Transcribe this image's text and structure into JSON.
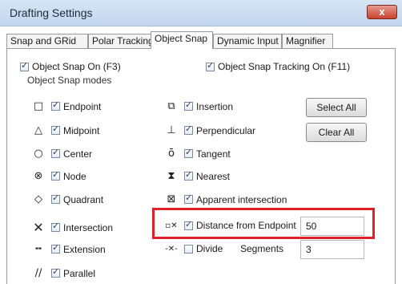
{
  "window": {
    "title": "Drafting Settings",
    "close_glyph": "x"
  },
  "tabs": [
    {
      "label": "Snap and GRid"
    },
    {
      "label": "Polar Tracking"
    },
    {
      "label": "Object Snap"
    },
    {
      "label": "Dynamic Input"
    },
    {
      "label": "Magnifier"
    }
  ],
  "active_tab": "Object Snap",
  "toggles": {
    "snap_on": {
      "label": "Object Snap On (F3)",
      "checked": true
    },
    "tracking_on": {
      "label": "Object Snap Tracking On (F11)",
      "checked": true
    }
  },
  "modes_group": {
    "label": "Object Snap modes"
  },
  "modes_left": [
    {
      "icon": "endpoint-icon",
      "label": "Endpoint",
      "checked": true
    },
    {
      "icon": "midpoint-icon",
      "label": "Midpoint",
      "checked": true
    },
    {
      "icon": "center-icon",
      "label": "Center",
      "checked": true
    },
    {
      "icon": "node-icon",
      "label": "Node",
      "checked": true
    },
    {
      "icon": "quadrant-icon",
      "label": "Quadrant",
      "checked": true
    },
    {
      "icon": "intersection-icon",
      "label": "Intersection",
      "checked": true
    },
    {
      "icon": "extension-icon",
      "label": "Extension",
      "checked": true
    },
    {
      "icon": "parallel-icon",
      "label": "Parallel",
      "checked": true
    }
  ],
  "modes_right": [
    {
      "icon": "insertion-icon",
      "label": "Insertion",
      "checked": true
    },
    {
      "icon": "perpendicular-icon",
      "label": "Perpendicular",
      "checked": true
    },
    {
      "icon": "tangent-icon",
      "label": "Tangent",
      "checked": true
    },
    {
      "icon": "nearest-icon",
      "label": "Nearest",
      "checked": true
    },
    {
      "icon": "apparent-intersection-icon",
      "label": "Apparent intersection",
      "checked": true
    },
    {
      "icon": "distance-from-endpoint-icon",
      "label": "Distance from Endpoint",
      "checked": true
    },
    {
      "icon": "divide-icon",
      "label": "Divide",
      "checked": false
    }
  ],
  "buttons": {
    "select_all": "Select All",
    "clear_all": "Clear All"
  },
  "distance": {
    "value": "50"
  },
  "segments": {
    "label": "Segments",
    "value": "3"
  },
  "colors": {
    "highlight": "#e0212b",
    "titlebar": "#c9daf0"
  }
}
